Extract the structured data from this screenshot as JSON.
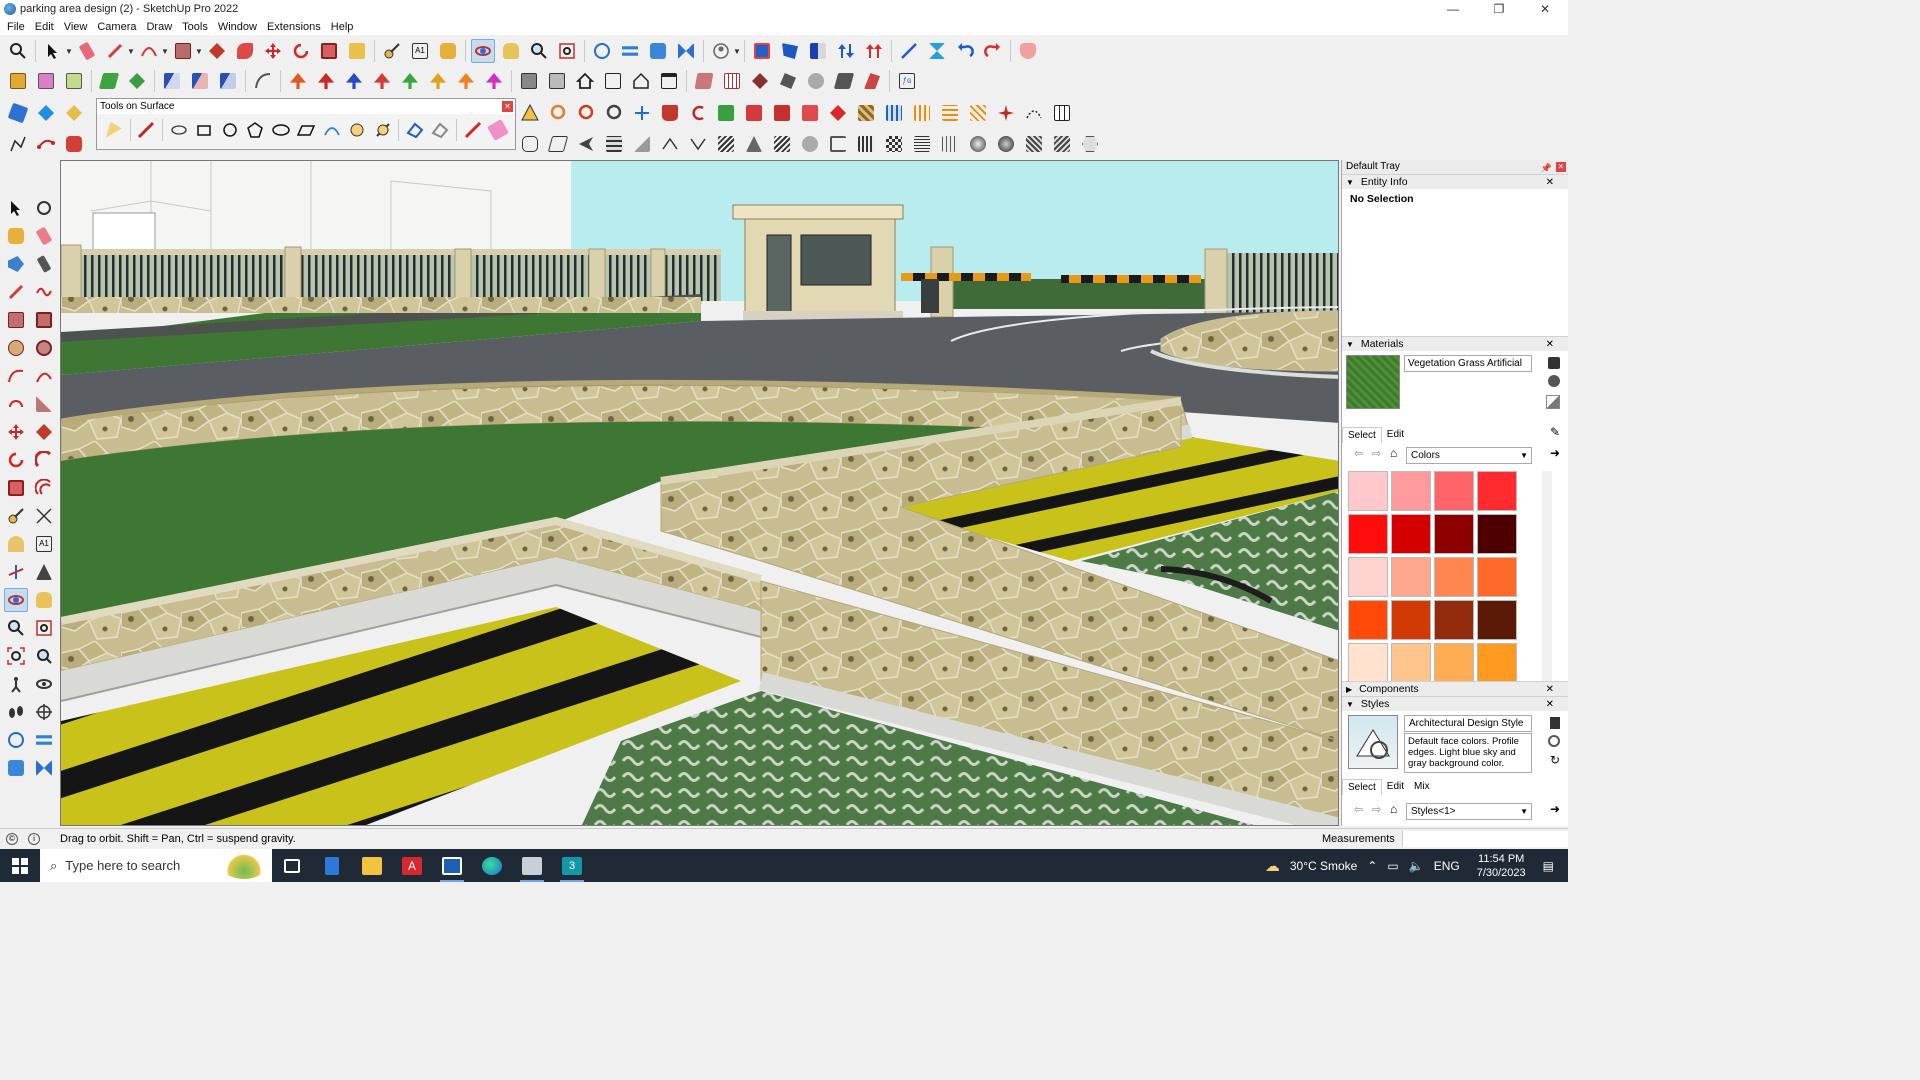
{
  "window": {
    "title": "parking area design (2) - SketchUp Pro 2022",
    "controls": [
      "—",
      "❐",
      "✕"
    ]
  },
  "menu": [
    "File",
    "Edit",
    "View",
    "Camera",
    "Draw",
    "Tools",
    "Window",
    "Extensions",
    "Help"
  ],
  "tools_on_surface": {
    "title": "Tools on Surface",
    "close": "✕"
  },
  "tray": {
    "title": "Default Tray",
    "entity_info": {
      "header": "Entity Info",
      "selection": "No Selection"
    },
    "materials": {
      "header": "Materials",
      "name": "Vegetation Grass Artificial",
      "tab_select": "Select",
      "tab_edit": "Edit",
      "library": "Colors",
      "swatches": [
        "#ffc8cb",
        "#ff9a9f",
        "#ff6468",
        "#ff2b2e",
        "#ff0d0d",
        "#d40000",
        "#8e0000",
        "#4e0000",
        "#ffd3cf",
        "#ffa78f",
        "#ff8650",
        "#ff6a2a",
        "#ff4a0a",
        "#d23a05",
        "#922b0c",
        "#5a1a06",
        "#ffe3cf",
        "#ffc58d",
        "#ffad55",
        "#ff9a20",
        "#ff8c00",
        "#d47000",
        "#8e4a00",
        "#4e2800"
      ]
    },
    "components": {
      "header": "Components"
    },
    "styles": {
      "header": "Styles",
      "name": "Architectural Design Style",
      "description": "Default face colors. Profile edges. Light blue sky and gray background color.",
      "tab_select": "Select",
      "tab_edit": "Edit",
      "tab_mix": "Mix",
      "collection": "Styles<1>"
    }
  },
  "status": {
    "hint": "Drag to orbit. Shift = Pan, Ctrl = suspend gravity.",
    "measurements_label": "Measurements"
  },
  "taskbar": {
    "search_placeholder": "Type here to search",
    "weather": "30°C  Smoke",
    "language": "ENG",
    "time": "11:54 PM",
    "date": "7/30/2023"
  },
  "colors": {
    "accent": "#1d6fd0",
    "sky": "#b9ecef",
    "grass": "#3f7a34",
    "asphalt": "#5a5e62",
    "stone": "#c5b98d",
    "hazard_yellow": "#c8c21c",
    "hazard_black": "#151515",
    "taskbar": "#1f2a36"
  }
}
